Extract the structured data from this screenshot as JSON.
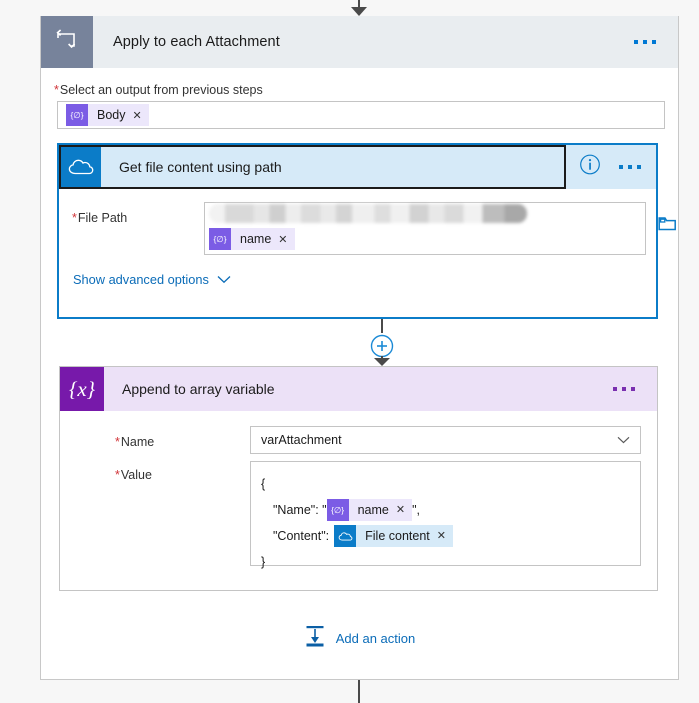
{
  "flow": {
    "loop": {
      "icon": "loop-icon",
      "title": "Apply to each Attachment",
      "ellipsis_label": "…",
      "select_output": {
        "required_marker": "*",
        "label": "Select an output from previous steps",
        "token": {
          "badge": "{∅}",
          "text": "Body",
          "remove": "✕"
        }
      }
    },
    "get_file_content": {
      "icon": "onedrive-icon",
      "title": "Get file content using path",
      "info_label": "i",
      "ellipsis_label": "…",
      "file_path": {
        "required_marker": "*",
        "label": "File Path",
        "redacted_value": "",
        "token": {
          "badge": "{∅}",
          "text": "name",
          "remove": "✕"
        },
        "folder_picker": "folder-icon"
      },
      "show_advanced_options": "Show advanced options"
    },
    "connector": {
      "add_step_label": "+"
    },
    "append_to_array": {
      "icon": "variables-icon",
      "icon_glyph": "{x}",
      "title": "Append to array variable",
      "ellipsis_label": "…",
      "name_field": {
        "required_marker": "*",
        "label": "Name",
        "value": "varAttachment"
      },
      "value_field": {
        "required_marker": "*",
        "label": "Value",
        "lines": {
          "open_brace": "{",
          "name_key": "\"Name\": \"",
          "name_token": {
            "badge": "{∅}",
            "text": "name",
            "remove": "✕"
          },
          "name_suffix": "\",",
          "content_key": "\"Content\":",
          "content_token": {
            "badge": "onedrive-icon",
            "text": "File content",
            "remove": "✕"
          },
          "close_brace": "}"
        }
      }
    },
    "add_action": {
      "icon": "add-action-icon",
      "label": "Add an action"
    }
  },
  "colors": {
    "loop_header_bg": "#e9edf0",
    "loop_icon_bg": "#77839b",
    "onedrive_blue": "#0b7cc8",
    "selected_border": "#0b7cc8",
    "variables_purple": "#7719aa",
    "variables_header_bg": "#ece1f7",
    "token_purple": "#7b5ce5",
    "link_blue": "#0b6cb8",
    "required_red": "#d13438"
  }
}
